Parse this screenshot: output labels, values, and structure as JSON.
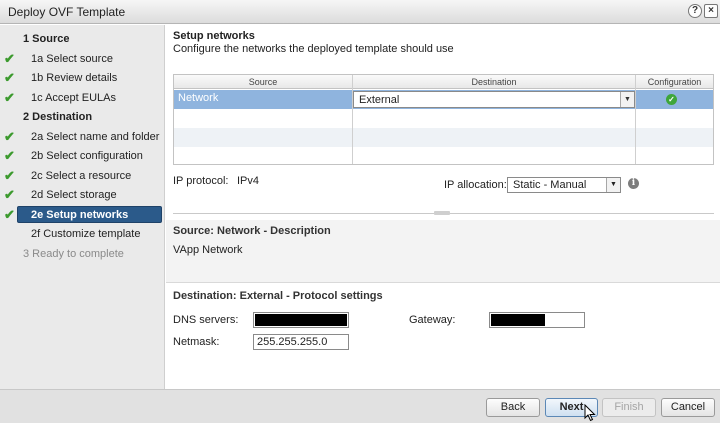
{
  "window": {
    "title": "Deploy OVF Template",
    "help_icon": "?",
    "close_icon": "×"
  },
  "sidebar": {
    "items": [
      {
        "label": "1  Source",
        "type": "head",
        "done": false
      },
      {
        "label": "1a  Select source",
        "type": "sub",
        "done": true
      },
      {
        "label": "1b  Review details",
        "type": "sub",
        "done": true
      },
      {
        "label": "1c  Accept EULAs",
        "type": "sub",
        "done": true
      },
      {
        "label": "2  Destination",
        "type": "head",
        "done": false
      },
      {
        "label": "2a  Select name and folder",
        "type": "sub",
        "done": true
      },
      {
        "label": "2b  Select configuration",
        "type": "sub",
        "done": true
      },
      {
        "label": "2c  Select a resource",
        "type": "sub",
        "done": true
      },
      {
        "label": "2d  Select storage",
        "type": "sub",
        "done": true
      },
      {
        "label": "2e  Setup networks",
        "type": "sub",
        "done": true,
        "active": true
      },
      {
        "label": "2f  Customize template",
        "type": "sub",
        "done": false
      },
      {
        "label": "3  Ready to complete",
        "type": "head-disabled",
        "done": false
      }
    ]
  },
  "main": {
    "title": "Setup networks",
    "subtitle": "Configure the networks the deployed template should use",
    "grid": {
      "columns": [
        "Source",
        "Destination",
        "Configuration"
      ],
      "rows": [
        {
          "source": "Network",
          "destination": "External",
          "status": "ok"
        }
      ]
    },
    "ip_protocol_label": "IP protocol:",
    "ip_protocol_value": "IPv4",
    "ip_allocation_label": "IP allocation:",
    "ip_allocation_value": "Static - Manual",
    "source_section_title": "Source: Network - Description",
    "source_description": "VApp Network",
    "dest_section_title": "Destination: External - Protocol settings",
    "dns_label": "DNS servers:",
    "gateway_label": "Gateway:",
    "netmask_label": "Netmask:",
    "netmask_value": "255.255.255.0"
  },
  "footer": {
    "back": "Back",
    "next": "Next",
    "finish": "Finish",
    "cancel": "Cancel"
  },
  "colors": {
    "active_step": "#2b5a8a",
    "selected_row": "#8fb4de",
    "check_green": "#3c9a2e"
  }
}
